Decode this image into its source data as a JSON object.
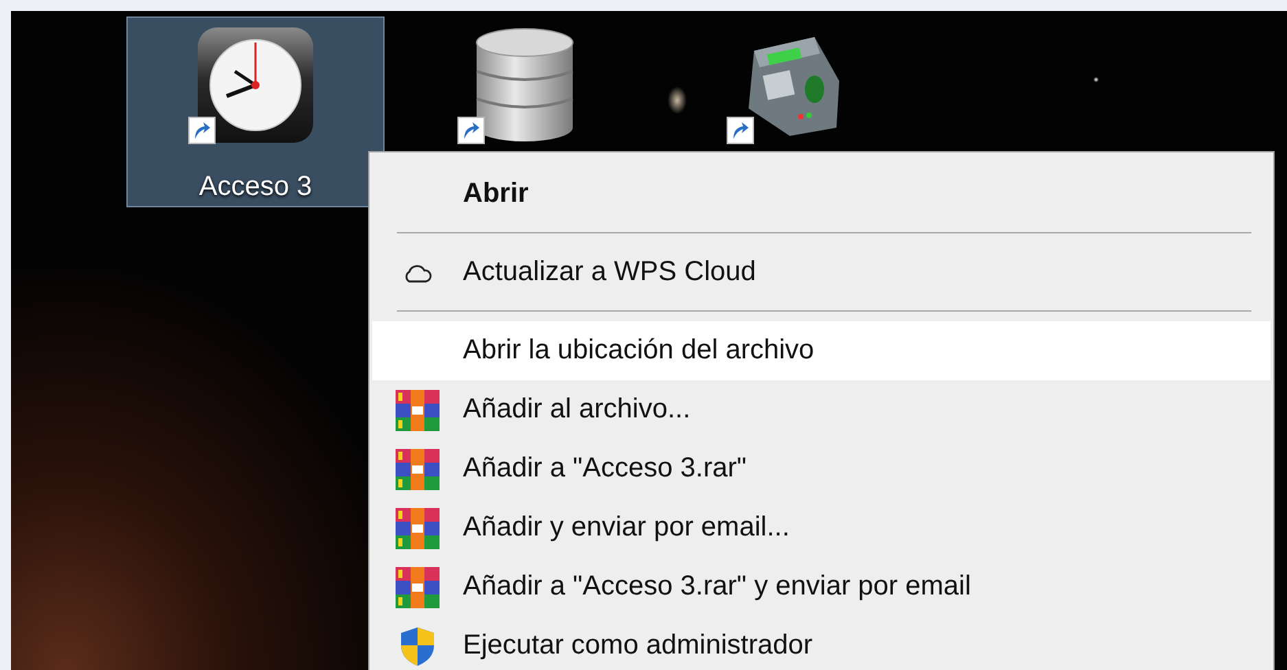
{
  "desktop_icons": [
    {
      "kind": "clock",
      "label": "Acceso 3",
      "selected": true
    },
    {
      "kind": "database",
      "selected": false
    },
    {
      "kind": "terminal",
      "selected": false
    }
  ],
  "context_menu": {
    "items": [
      {
        "kind": "plain",
        "label": "Abrir",
        "default": true,
        "selected": false
      },
      {
        "kind": "separator"
      },
      {
        "kind": "cloud",
        "label": "Actualizar a WPS Cloud",
        "default": false,
        "selected": false
      },
      {
        "kind": "separator"
      },
      {
        "kind": "plain",
        "label": "Abrir la ubicación del archivo",
        "default": false,
        "selected": true
      },
      {
        "kind": "archive",
        "label": "Añadir al archivo...",
        "default": false,
        "selected": false
      },
      {
        "kind": "archive",
        "label": "Añadir a \"Acceso 3.rar\"",
        "default": false,
        "selected": false
      },
      {
        "kind": "archive",
        "label": "Añadir y enviar por email...",
        "default": false,
        "selected": false
      },
      {
        "kind": "archive",
        "label": "Añadir a \"Acceso 3.rar\" y enviar por email",
        "default": false,
        "selected": false
      },
      {
        "kind": "shield",
        "label": "Ejecutar como administrador",
        "default": false,
        "selected": false
      }
    ]
  }
}
